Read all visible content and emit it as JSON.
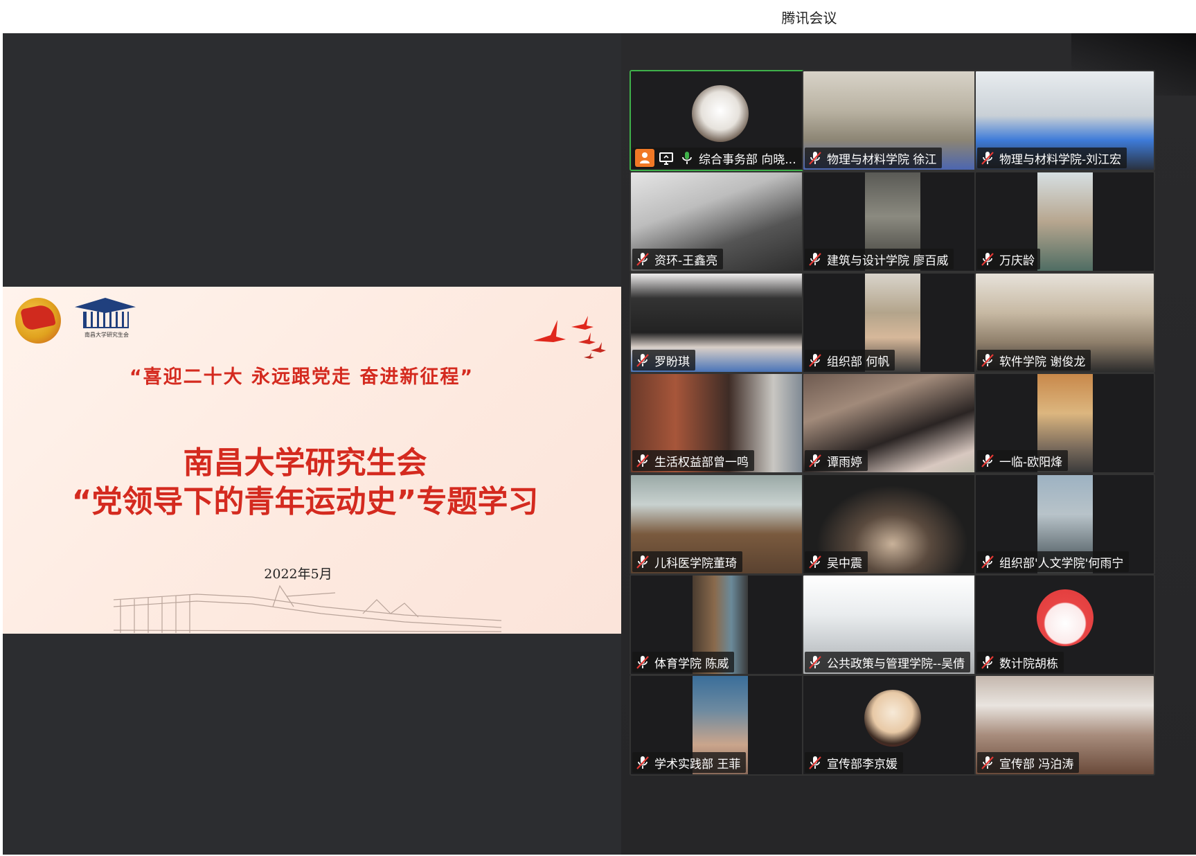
{
  "window": {
    "title": "腾讯会议"
  },
  "slide": {
    "union_logo_caption": "南昌大学研究生会",
    "slogan": "“喜迎二十大  永远跟党走  奋进新征程”",
    "heading_line1": "南昌大学研究生会",
    "heading_line2": "“党领导下的青年运动史”专题学习",
    "date": "2022年5月"
  },
  "participants": [
    {
      "name": "综合事务部 向晓...",
      "role": "host",
      "mic": "on"
    },
    {
      "name": "物理与材料学院 徐江",
      "mic": "muted"
    },
    {
      "name": "物理与材料学院-刘江宏",
      "mic": "muted"
    },
    {
      "name": "资环-王鑫亮",
      "mic": "muted"
    },
    {
      "name": "建筑与设计学院 廖百威",
      "mic": "muted"
    },
    {
      "name": "万庆龄",
      "mic": "muted"
    },
    {
      "name": "罗盼琪",
      "mic": "muted"
    },
    {
      "name": "组织部 何帆",
      "mic": "muted"
    },
    {
      "name": "软件学院 谢俊龙",
      "mic": "muted"
    },
    {
      "name": "生活权益部曾一鸣",
      "mic": "muted"
    },
    {
      "name": "谭雨婷",
      "mic": "muted"
    },
    {
      "name": "一临-欧阳烽",
      "mic": "muted"
    },
    {
      "name": "儿科医学院董琦",
      "mic": "muted"
    },
    {
      "name": "吴中震",
      "mic": "muted"
    },
    {
      "name": "组织部'人文学院'何雨宁",
      "mic": "muted"
    },
    {
      "name": "体育学院 陈威",
      "mic": "muted"
    },
    {
      "name": "公共政策与管理学院--吴倩",
      "mic": "muted"
    },
    {
      "name": "数计院胡栋",
      "mic": "muted"
    },
    {
      "name": "学术实践部 王菲",
      "mic": "muted"
    },
    {
      "name": "宣传部李京媛",
      "mic": "muted"
    },
    {
      "name": "宣传部 冯泊涛",
      "mic": "muted"
    }
  ],
  "colors": {
    "active_speaker_border": "#3fb14a",
    "slide_accent": "#d42a1f",
    "host_badge": "#f07826"
  }
}
